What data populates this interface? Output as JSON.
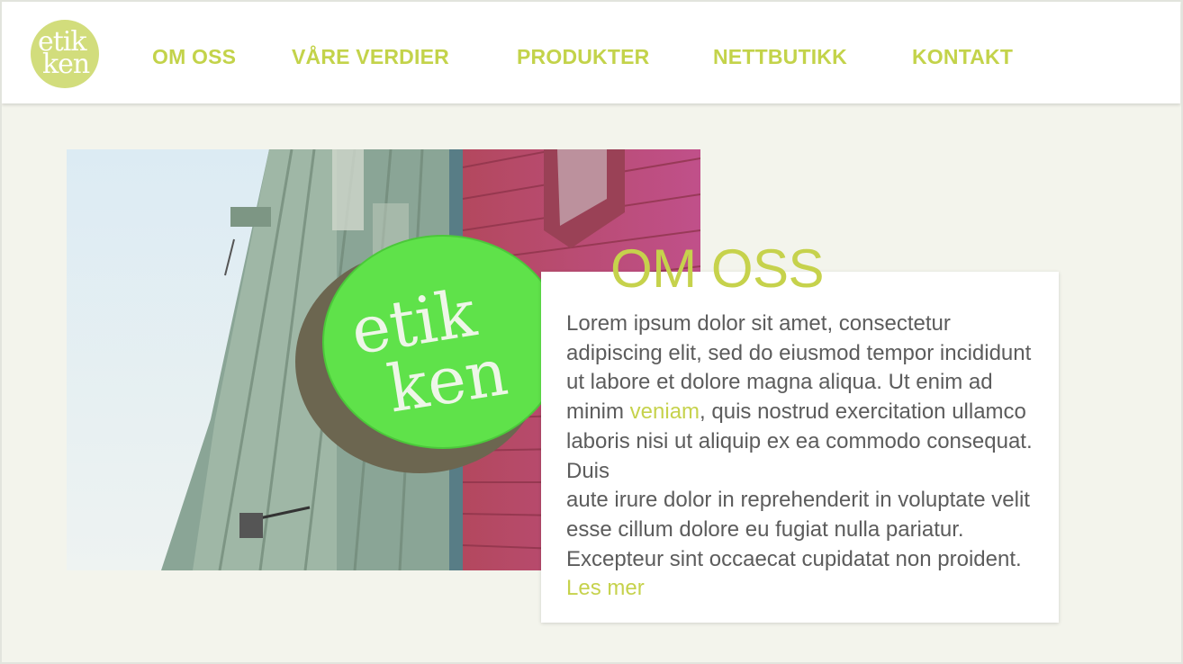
{
  "logo": {
    "line1": "etik",
    "line2": "ken"
  },
  "nav": {
    "items": [
      {
        "label": "OM OSS"
      },
      {
        "label": "VÅRE VERDIER"
      },
      {
        "label": "PRODUKTER"
      },
      {
        "label": "NETTBUTIKK"
      },
      {
        "label": "KONTAKT"
      }
    ]
  },
  "hero": {
    "sign_line1": "etik",
    "sign_line2": "ken"
  },
  "about": {
    "title": "OM OSS",
    "text_before_link": "Lorem ipsum dolor sit amet, consectetur adipiscing elit, sed do eiusmod tempor incididunt ut labore et dolore magna aliqua. Ut enim ad minim ",
    "inline_word": "veniam",
    "text_after_word": ", quis nostrud exercitation ullamco laboris nisi ut aliquip ex ea commodo consequat. Duis",
    "text_second": "aute irure dolor in reprehenderit in voluptate velit esse cillum dolore eu fugiat nulla pariatur. Excepteur sint occaecat cupidatat non proident. ",
    "read_more": "Les mer"
  },
  "colors": {
    "accent": "#c3d34a",
    "logo_bg": "#d2dd7c",
    "page_bg": "#f3f4ec",
    "sign_green": "#5fe24a"
  }
}
